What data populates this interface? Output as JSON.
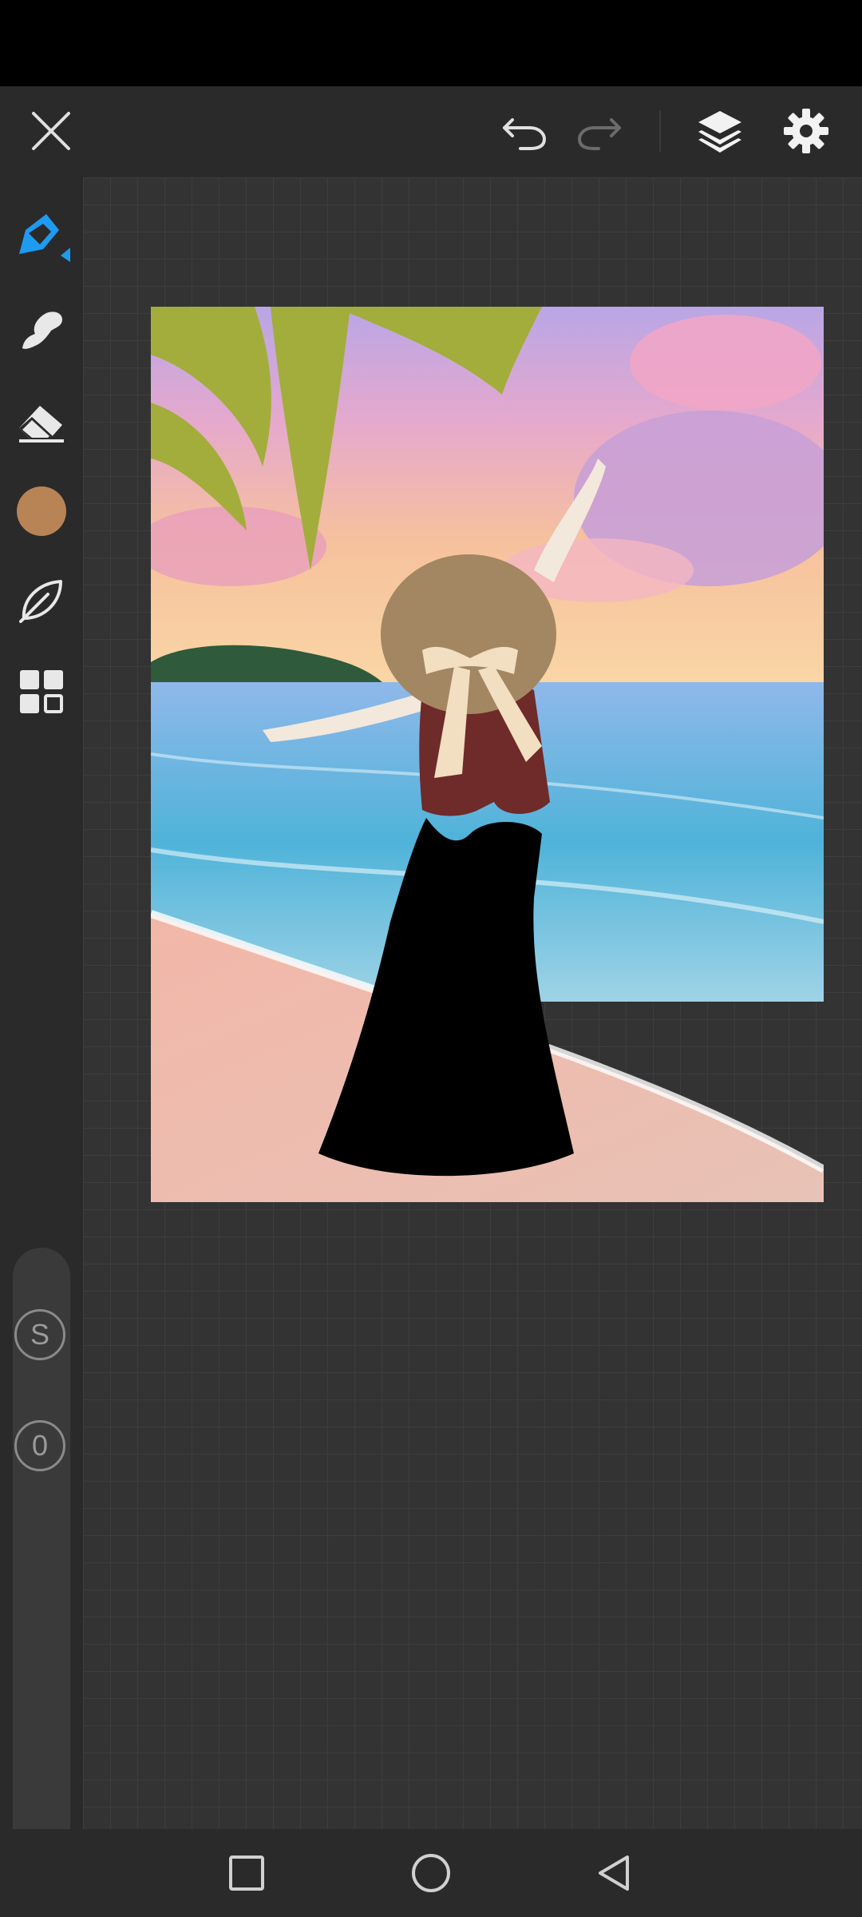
{
  "app": {
    "screen": "drawing-canvas"
  },
  "toolbar": {
    "close_icon": "close-icon",
    "undo_icon": "undo-icon",
    "redo_icon": "redo-icon",
    "layers_icon": "layers-icon",
    "settings_icon": "gear-icon"
  },
  "tools": {
    "items": [
      {
        "name": "pen",
        "icon": "pen-tool-icon",
        "active": true
      },
      {
        "name": "smudge",
        "icon": "smudge-tool-icon",
        "active": false
      },
      {
        "name": "eraser",
        "icon": "eraser-tool-icon",
        "active": false
      },
      {
        "name": "color",
        "icon": "color-swatch",
        "active": false
      },
      {
        "name": "brush-library",
        "icon": "leaf-brush-icon",
        "active": false
      },
      {
        "name": "widgets",
        "icon": "grid-icon",
        "active": false
      }
    ],
    "current_color": "#B88455",
    "accent_color": "#1E9BF0"
  },
  "side_controls": {
    "stabilizer_label": "S",
    "opacity_label": "0"
  },
  "colors": {
    "background": "#2A2A2A",
    "canvas_grid": "#333333",
    "status_bar": "#000000"
  },
  "nav": {
    "recents_icon": "square-icon",
    "home_icon": "circle-icon",
    "back_icon": "triangle-back-icon"
  }
}
